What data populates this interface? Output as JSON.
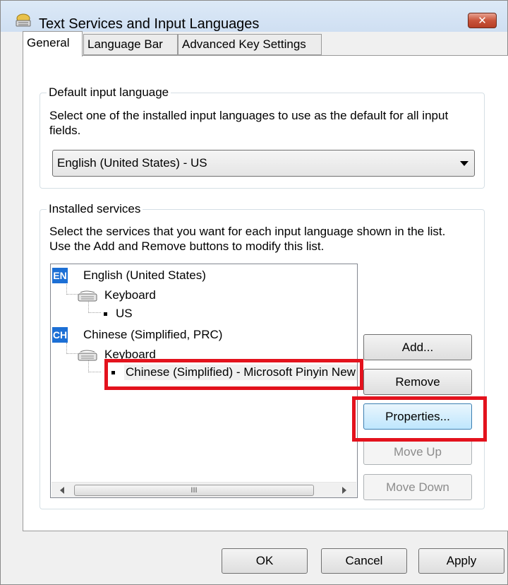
{
  "window": {
    "title": "Text Services and Input Languages",
    "close_glyph": "✕"
  },
  "tabs": [
    {
      "label": "General",
      "selected": true
    },
    {
      "label": "Language Bar",
      "selected": false
    },
    {
      "label": "Advanced Key Settings",
      "selected": false
    }
  ],
  "default_input": {
    "legend": "Default input language",
    "description_line1": "Select one of the installed input languages to use as the default for all input",
    "description_line2": "fields.",
    "selected": "English (United States) - US"
  },
  "installed": {
    "legend": "Installed services",
    "description_line1": "Select the services that you want for each input language shown in the list.",
    "description_line2": "Use the Add and Remove buttons to modify this list.",
    "tree": {
      "lang1_badge": "EN",
      "lang1": "English (United States)",
      "lang1_keyboard": "Keyboard",
      "lang1_layout": "US",
      "lang2_badge": "CH",
      "lang2": "Chinese (Simplified, PRC)",
      "lang2_keyboard": "Keyboard",
      "lang2_ime": "Chinese (Simplified) - Microsoft Pinyin New Experience Input Style"
    },
    "scroll_thumb_glyph": "III",
    "buttons": {
      "add": "Add...",
      "remove": "Remove",
      "properties": "Properties...",
      "move_up": "Move Up",
      "move_down": "Move Down"
    }
  },
  "footer": {
    "ok": "OK",
    "cancel": "Cancel",
    "apply": "Apply"
  },
  "colors": {
    "highlight": "#e3121d",
    "badge": "#1c6fd5"
  }
}
